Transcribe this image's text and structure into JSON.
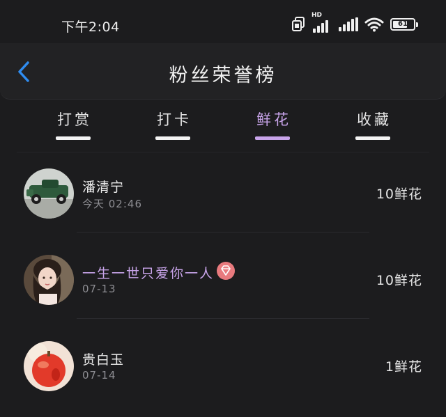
{
  "status_bar": {
    "time": "下午2:04",
    "network_label": "HD",
    "battery": "61"
  },
  "header": {
    "title": "粉丝荣誉榜"
  },
  "tabs": [
    {
      "label": "打赏",
      "active": false
    },
    {
      "label": "打卡",
      "active": false
    },
    {
      "label": "鲜花",
      "active": true
    },
    {
      "label": "收藏",
      "active": false
    }
  ],
  "fans": [
    {
      "name": "潘清宁",
      "time": "今天 02:46",
      "value": "10鲜花",
      "vip": false,
      "avatar": "vintage-car-avatar"
    },
    {
      "name": "一生一世只爱你一人",
      "time": "07-13",
      "value": "10鲜花",
      "vip": true,
      "avatar": "woman-portrait-avatar"
    },
    {
      "name": "贵白玉",
      "time": "07-14",
      "value": "1鲜花",
      "vip": false,
      "avatar": "red-fruit-avatar"
    }
  ],
  "colors": {
    "accent": "#c8a4ea",
    "back": "#2f8cf0",
    "background": "#1c1c1e"
  }
}
